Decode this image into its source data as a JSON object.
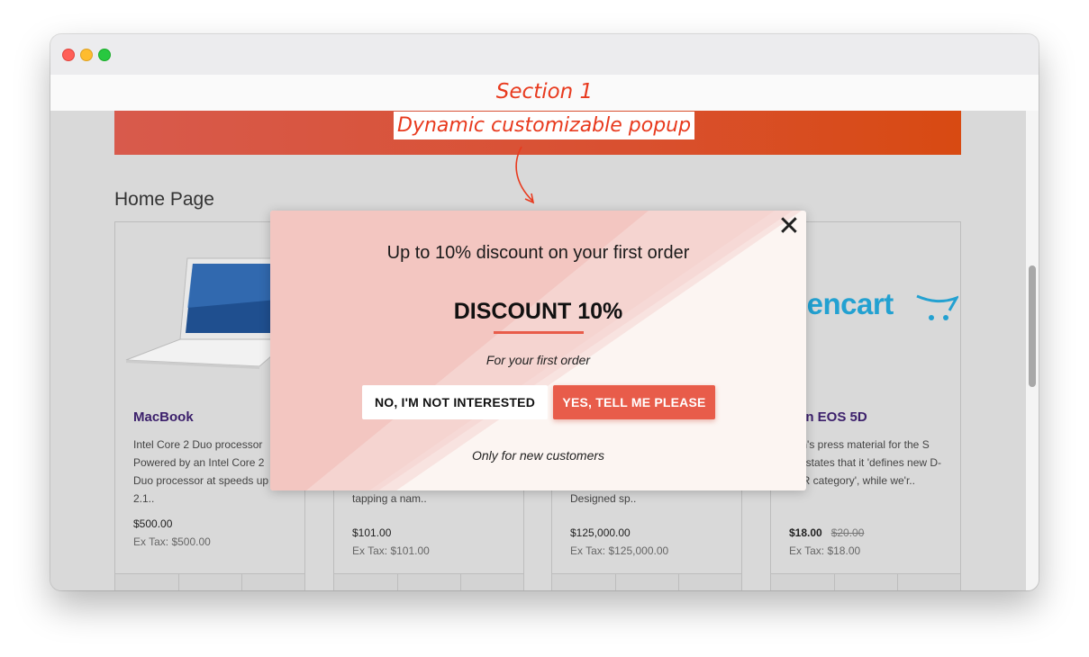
{
  "annotation": {
    "section_label": "Section 1",
    "callout_label": "Dynamic customizable popup"
  },
  "page": {
    "heading": "Home Page"
  },
  "products": [
    {
      "name": "MacBook",
      "desc": "Intel Core 2 Duo processor Powered by an Intel Core 2 Duo processor at speeds up to 2.1..",
      "price": "$500.00",
      "ex_tax": "Ex Tax: $500.00"
    },
    {
      "name": "",
      "desc": "tapping a nam..",
      "price": "$101.00",
      "ex_tax": "Ex Tax: $101.00"
    },
    {
      "name": "",
      "desc": "Designed sp..",
      "price": "$125,000.00",
      "ex_tax": "Ex Tax: $125,000.00"
    },
    {
      "name": "non EOS 5D",
      "desc": "non's press material for the S 5D states that it 'defines new D-SLR category', while we'r..",
      "price": "$18.00",
      "price_old": "$20.00",
      "ex_tax": "Ex Tax: $18.00",
      "logo_text": "pencart"
    }
  ],
  "popup": {
    "title": "Up to 10% discount on your first order",
    "headline": "DISCOUNT 10%",
    "subtitle": "For your first order",
    "decline_label": "NO, I'M NOT INTERESTED",
    "accept_label": "YES, TELL ME PLEASE",
    "footer": "Only for new customers",
    "close_symbol": "✕"
  },
  "colors": {
    "accent": "#e85c4a",
    "annotation": "#e83a1e",
    "product_link": "#3b1f6b",
    "brand_blue": "#23a1d1"
  }
}
